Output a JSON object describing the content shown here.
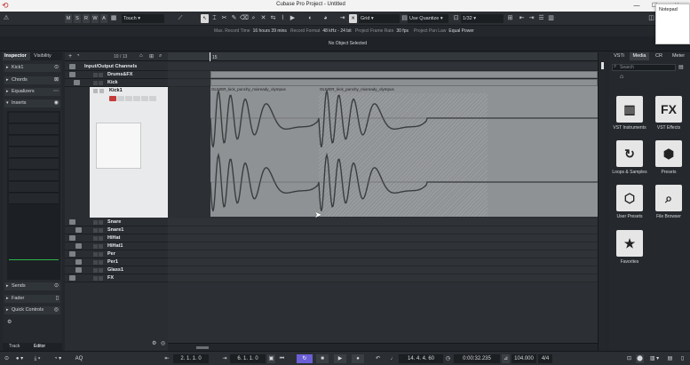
{
  "window": {
    "title": "Cubase Pro Project - Untitled",
    "minimize": "—",
    "maximize": "☐",
    "close": "✕"
  },
  "notepad_popup": "Notepad",
  "toolbar": {
    "buttons": [
      "M",
      "S",
      "R",
      "W",
      "A"
    ],
    "automation_mode": "Touch",
    "snap_mode": "Grid",
    "quantize_type": "Use Quantize",
    "quantize_value": "1/32"
  },
  "statusline": {
    "max_record_time_label": "Max. Record Time",
    "max_record_time": "16 hours 39 mins",
    "record_format_label": "Record Format",
    "record_format": "48 kHz - 24 bit",
    "frame_rate_label": "Project Frame Rate",
    "frame_rate": "30 fps",
    "pan_law_label": "Project Pan Law",
    "pan_law": "Equal Power"
  },
  "infoline": "No Object Selected",
  "inspector": {
    "tabs": [
      "Inspector",
      "Visibility"
    ],
    "track_name": "Kick1",
    "sections": [
      "Chords",
      "Equalizers",
      "Inserts"
    ],
    "bottom_sections": [
      "Sends",
      "Fader",
      "Quick Controls"
    ],
    "bottom_tabs": [
      "Track",
      "Editor"
    ]
  },
  "track_list": {
    "counter": "10 / 13",
    "tracks": [
      {
        "name": "Input/Output Channels"
      },
      {
        "name": "Drums&FX"
      },
      {
        "name": "Kick"
      },
      {
        "name": "Kick1"
      },
      {
        "name": "Snare"
      },
      {
        "name": "Snare1"
      },
      {
        "name": "HiHat"
      },
      {
        "name": "HiHat1"
      },
      {
        "name": "Per"
      },
      {
        "name": "Per1"
      },
      {
        "name": "Glass1"
      },
      {
        "name": "FX"
      }
    ]
  },
  "project": {
    "ruler_bar": "15",
    "events": [
      "OLIVER_kick_punchy_mixready_olympus",
      "OLIVER_kick_punchy_mixready_olympus"
    ]
  },
  "rack": {
    "tabs": [
      "VSTi",
      "Media",
      "CR",
      "Meter"
    ],
    "search_placeholder": "Search",
    "tiles": [
      {
        "label": "VST Instruments",
        "icon": "piano-icon"
      },
      {
        "label": "VST Effects",
        "icon": "fx-icon"
      },
      {
        "label": "Loops & Samples",
        "icon": "loop-icon"
      },
      {
        "label": "Presets",
        "icon": "presets-icon"
      },
      {
        "label": "User Presets",
        "icon": "user-presets-icon"
      },
      {
        "label": "File Browser",
        "icon": "file-browser-icon"
      },
      {
        "label": "Favorites",
        "icon": "star-icon"
      }
    ]
  },
  "transport": {
    "left_locator": "2. 1. 1. 0",
    "right_locator": "6. 1. 1. 0",
    "position_bars": "14. 4. 4. 60",
    "position_time": "0:00:32.235",
    "tempo": "104.000",
    "signature": "4/4",
    "aq": "AQ"
  },
  "colors": {
    "accent": "#6b5fd6",
    "event": "#8f9295",
    "record": "#c63a3a"
  }
}
